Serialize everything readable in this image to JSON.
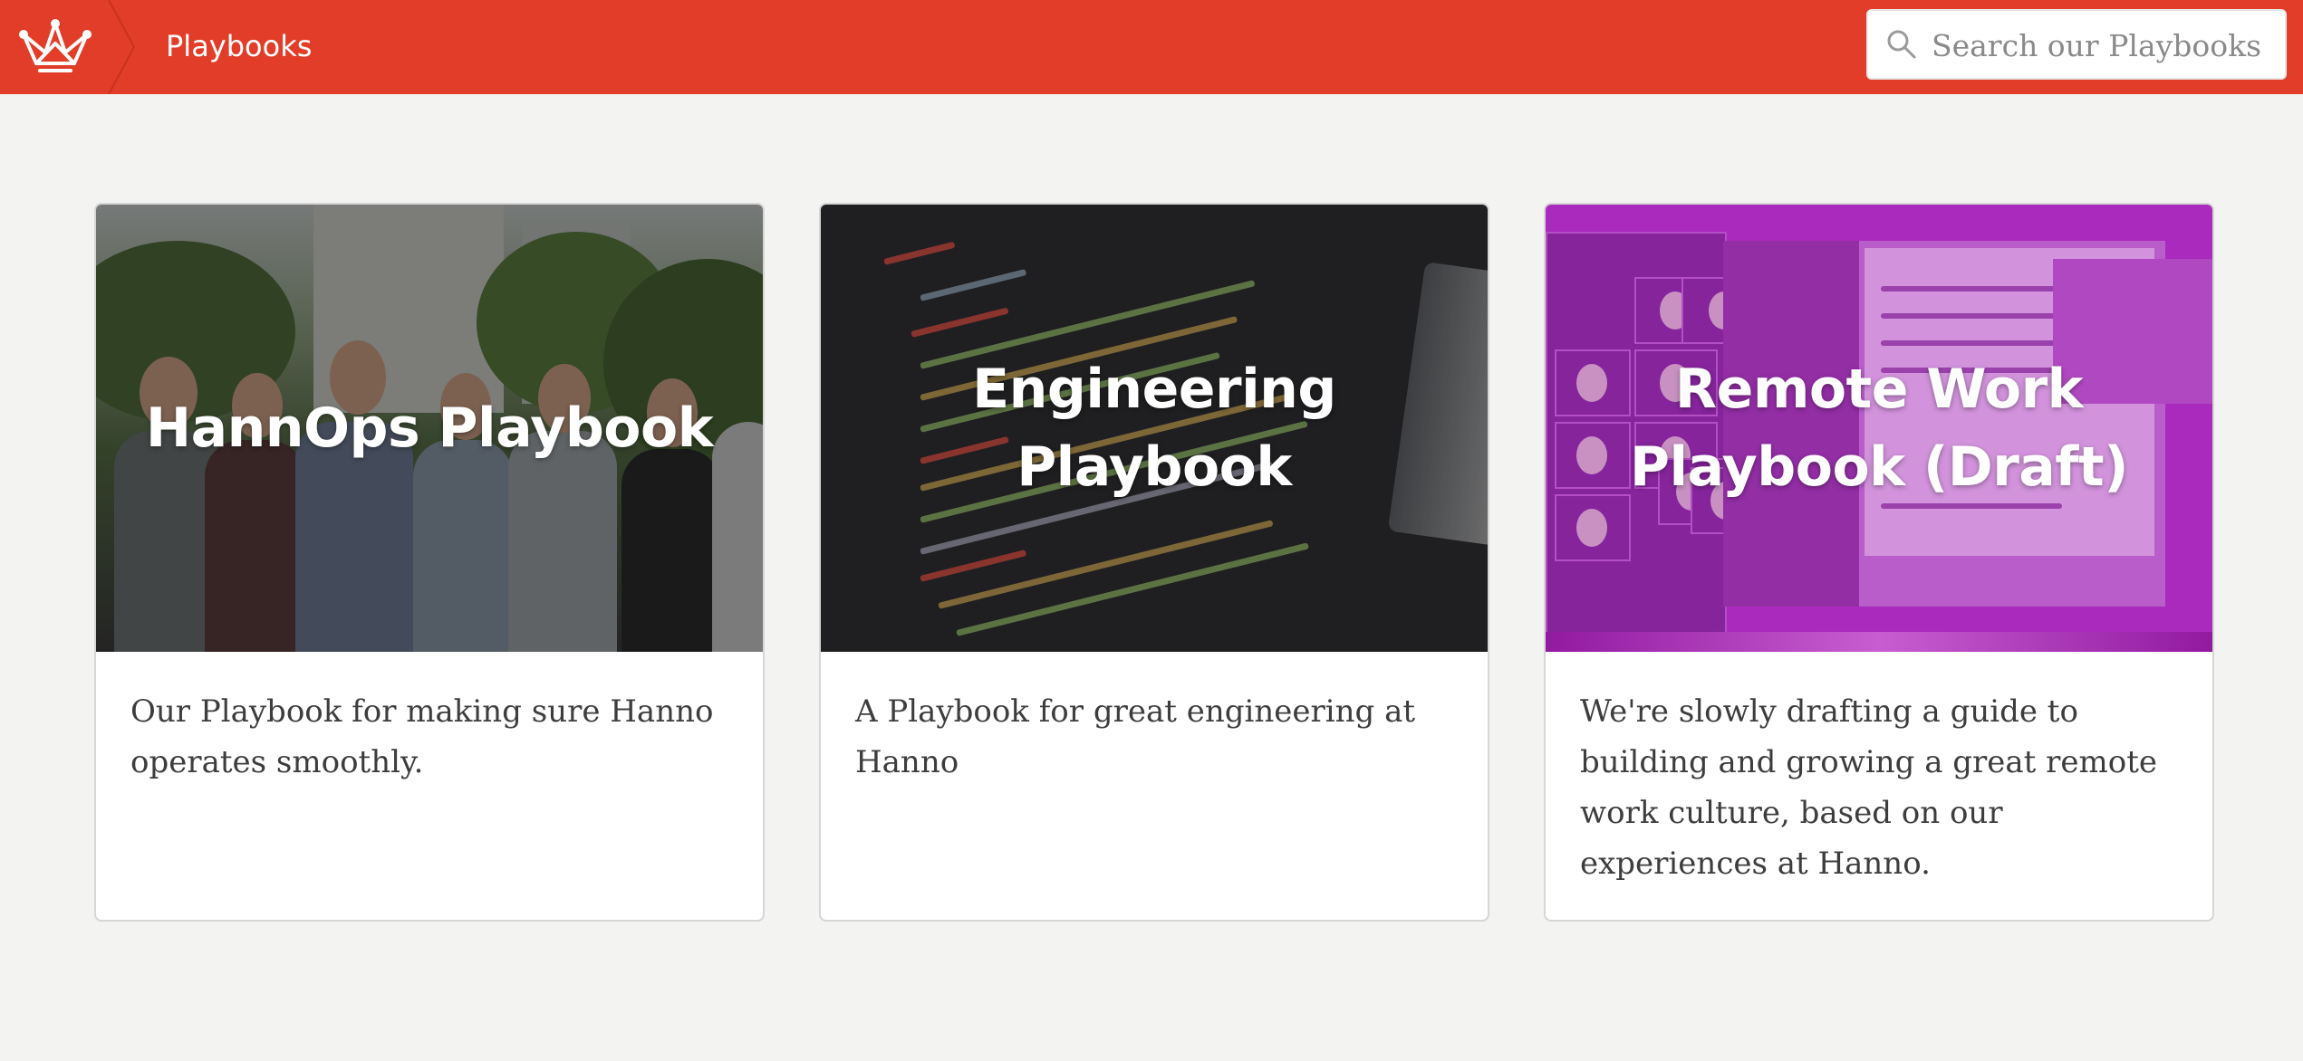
{
  "header": {
    "title": "Playbooks",
    "logo_icon": "crown-icon",
    "accent_color": "#e13d28",
    "search": {
      "placeholder": "Search our Playbooks",
      "value": "",
      "icon": "search-icon"
    }
  },
  "cards": [
    {
      "title": "HannOps Playbook",
      "description": "Our Playbook for making sure Hanno operates smoothly."
    },
    {
      "title": "Engineering Playbook",
      "description": "A Playbook for great engineering at Hanno"
    },
    {
      "title": "Remote Work Playbook (Draft)",
      "description": "We're slowly drafting a guide to building and growing a great remote work culture, based on our experiences at Hanno."
    }
  ]
}
